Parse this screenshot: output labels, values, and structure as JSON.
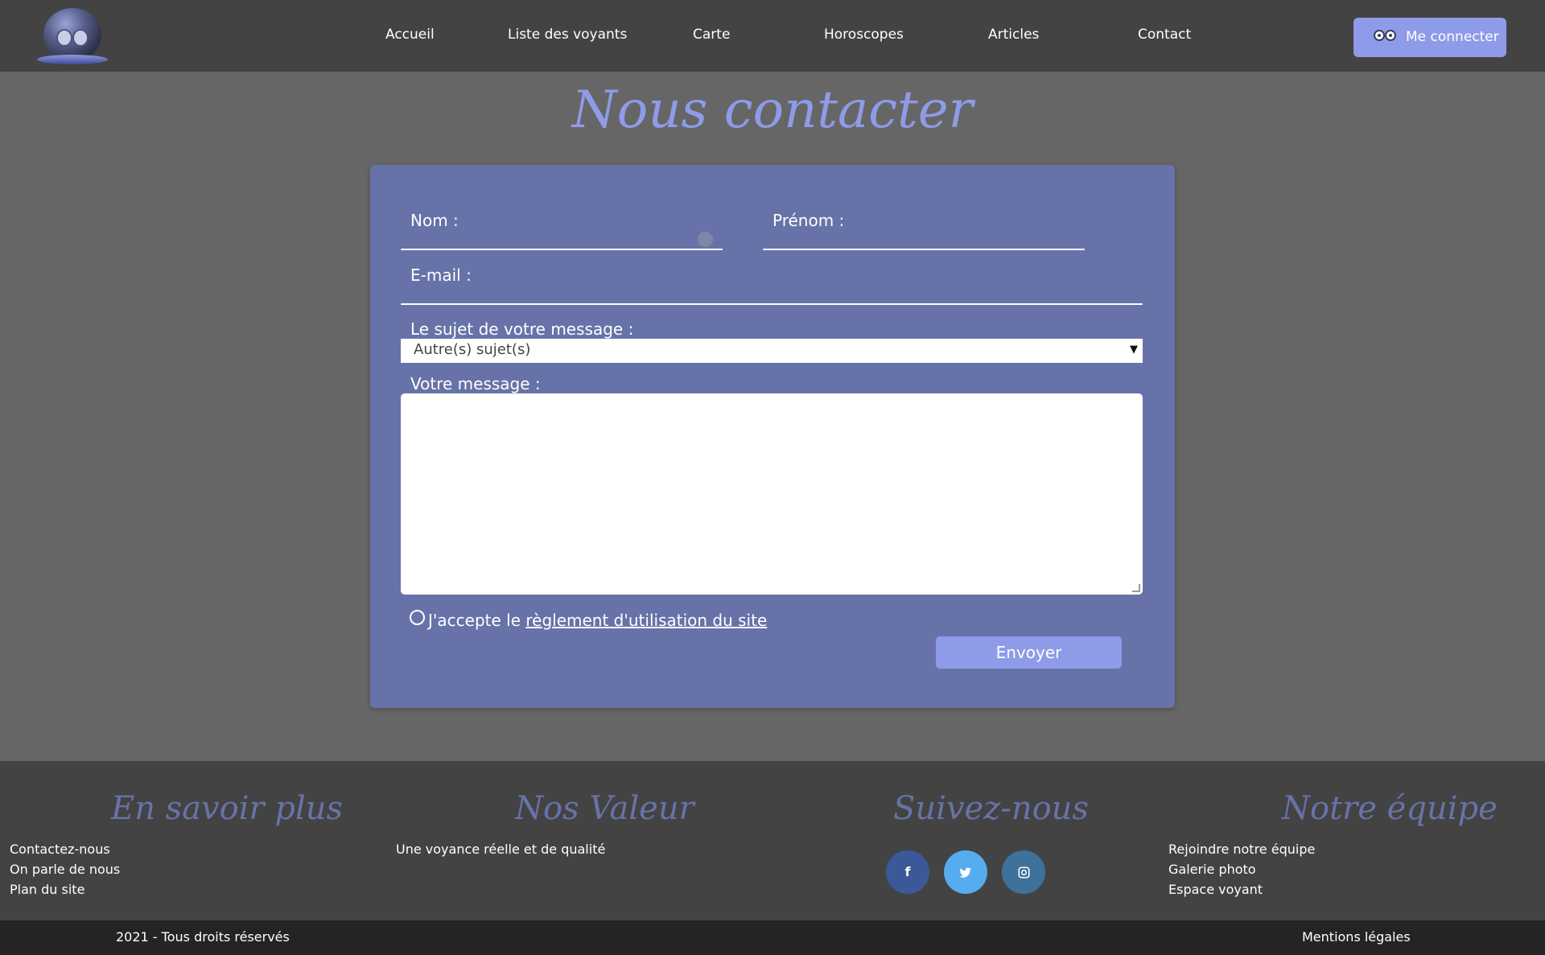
{
  "header": {
    "nav": [
      "Accueil",
      "Liste des voyants",
      "Carte",
      "Horoscopes",
      "Articles",
      "Contact"
    ],
    "login_label": "Me connecter"
  },
  "page_title": "Nous contacter",
  "form": {
    "nom_label": "Nom :",
    "prenom_label": "Prénom :",
    "email_label": "E-mail :",
    "subject_label": "Le sujet de votre message :",
    "subject_value": "Autre(s) sujet(s)",
    "message_label": "Votre message :",
    "accept_text": "J'accepte le ",
    "accept_link": "règlement d'utilisation du site",
    "send_label": "Envoyer"
  },
  "footer": {
    "col1": {
      "title": "En savoir plus",
      "links": [
        "Contactez-nous",
        "On parle de nous",
        "Plan du site"
      ]
    },
    "col2": {
      "title": "Nos Valeur",
      "text": "Une voyance réelle et de qualité"
    },
    "col3": {
      "title": "Suivez-nous",
      "icons": [
        "facebook-icon",
        "twitter-icon",
        "instagram-icon"
      ]
    },
    "col4": {
      "title": "Notre équipe",
      "links": [
        "Rejoindre notre équipe",
        "Galerie photo",
        "Espace voyant"
      ]
    },
    "copyright": "2021 - Tous droits réservés",
    "legal": "Mentions légales"
  },
  "colors": {
    "accent": "#8e9be8",
    "card": "#6773a8",
    "header_bg": "#434343",
    "page_bg": "#666666",
    "facebook": "#3b5998",
    "twitter": "#55acee",
    "instagram": "#3f729b"
  }
}
